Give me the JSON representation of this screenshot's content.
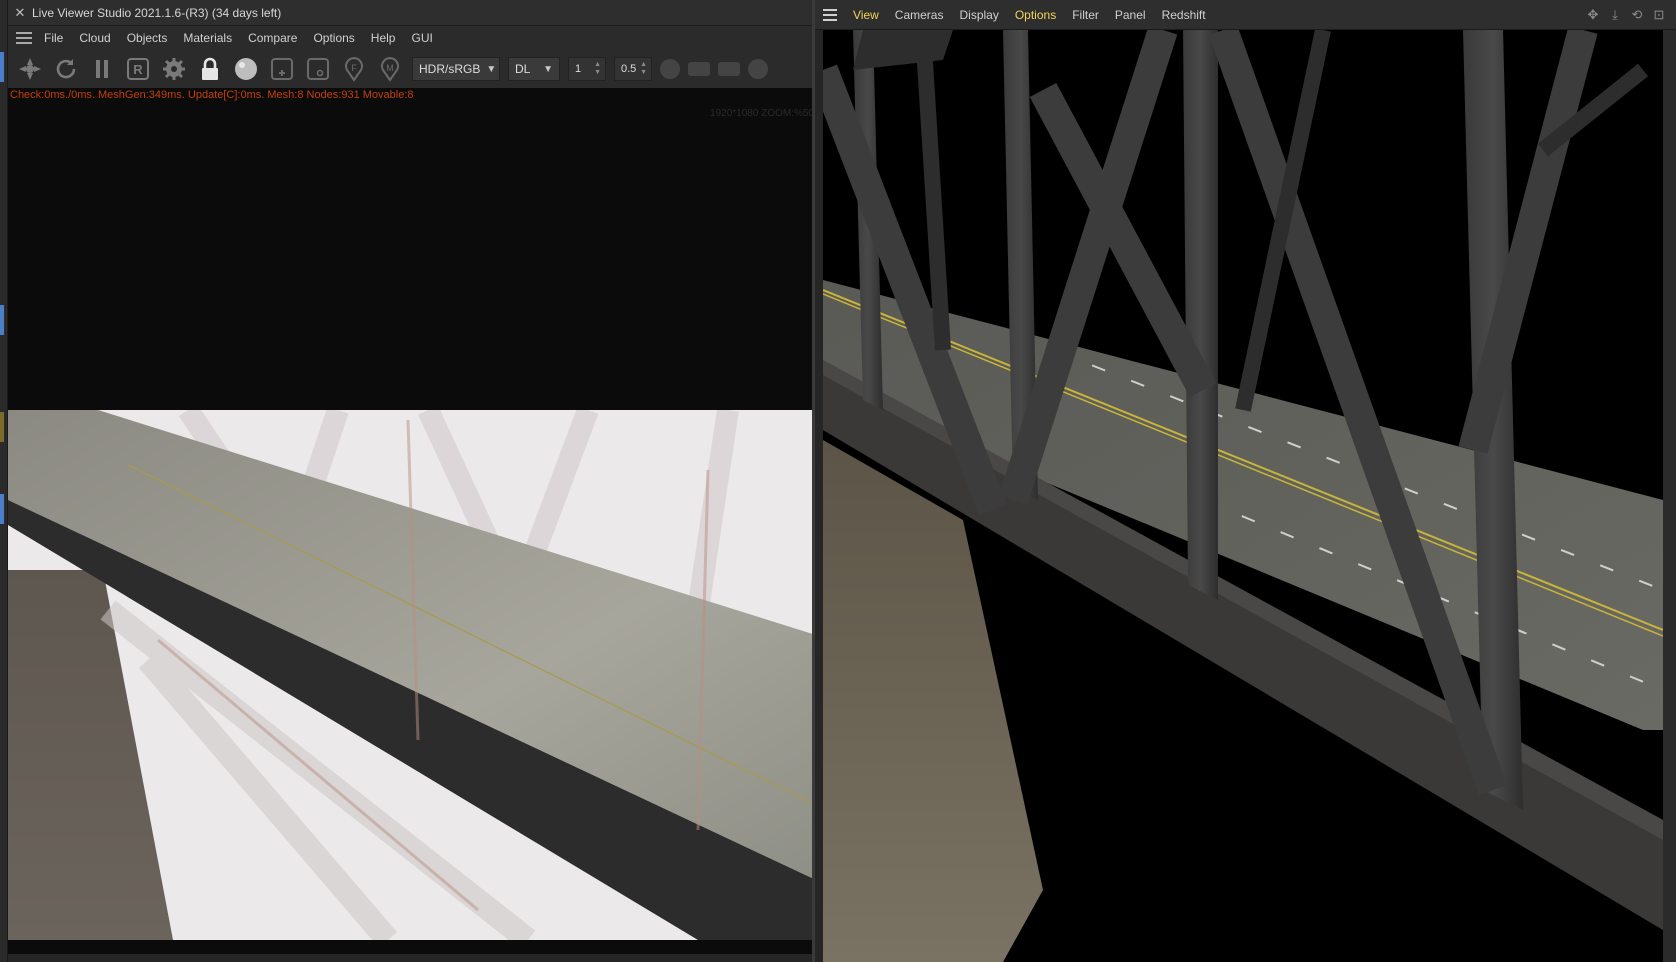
{
  "left_window": {
    "title": "Live Viewer Studio 2021.1.6-(R3) (34 days left)",
    "close_glyph": "✕",
    "menu": [
      "File",
      "Cloud",
      "Objects",
      "Materials",
      "Compare",
      "Options",
      "Help",
      "GUI"
    ],
    "toolbar": {
      "icons": [
        "spin-icon",
        "refresh-icon",
        "pause-icon",
        "region-icon",
        "settings-gear-icon",
        "lock-icon",
        "sphere-icon",
        "add-frame-icon",
        "frame-icon",
        "focus-pin-icon",
        "material-pin-icon"
      ],
      "colorspace_value": "HDR/sRGB",
      "mode_value": "DL",
      "samples_value": "1",
      "scale_value": "0.5"
    },
    "status_text": "Check:0ms./0ms. MeshGen:349ms. Update[C]:0ms. Mesh:8 Nodes:931 Movable:8",
    "zoom_text": "1920*1080 ZOOM:%50"
  },
  "right_window": {
    "menu": [
      {
        "label": "View",
        "active": true
      },
      {
        "label": "Cameras",
        "active": false
      },
      {
        "label": "Display",
        "active": false
      },
      {
        "label": "Options",
        "active": true
      },
      {
        "label": "Filter",
        "active": false
      },
      {
        "label": "Panel",
        "active": false
      },
      {
        "label": "Redshift",
        "active": false
      }
    ],
    "nav_icons": [
      "move-icon",
      "pan-down-icon",
      "rotate-icon",
      "maximize-icon"
    ]
  },
  "colors": {
    "accent_yellow": "#f2d35b",
    "status_orange": "#c2410c",
    "panel_bg": "#2b2b2b",
    "viewport_bg": "#0b0b0b"
  }
}
